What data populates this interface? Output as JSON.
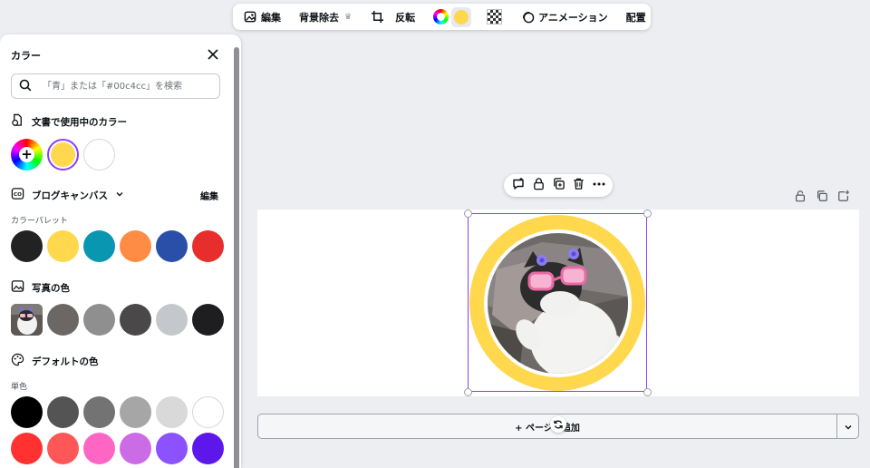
{
  "toolbar": {
    "edit_label": "編集",
    "bg_remove_label": "背景除去",
    "flip_label": "反転",
    "animation_label": "アニメーション",
    "arrange_label": "配置"
  },
  "color_panel": {
    "title": "カラー",
    "search_placeholder": "「青」または「#00c4cc」を検索",
    "doc_colors": {
      "title": "文書で使用中のカラー",
      "swatches": [
        "#ffd84d",
        "#ffffff"
      ]
    },
    "brand_kit": {
      "title": "ブログキャンバス",
      "edit_label": "編集",
      "palette_label": "カラーパレット",
      "swatches": [
        "#222222",
        "#ffd84d",
        "#0996b1",
        "#ff8c45",
        "#2a4fa8",
        "#e82d2d"
      ]
    },
    "photo_colors": {
      "title": "写真の色",
      "swatches": [
        "#6b6765",
        "#8f8f8f",
        "#4a4848",
        "#c4c8cc",
        "#1e1e20"
      ]
    },
    "default_colors": {
      "title": "デフォルトの色",
      "mono_label": "単色",
      "row1": [
        "#000000",
        "#545454",
        "#737373",
        "#a6a6a6",
        "#d9d9d9",
        "#ffffff"
      ],
      "row2": [
        "#ff3131",
        "#ff5757",
        "#ff66c4",
        "#cb6ce6",
        "#8c52ff",
        "#5e17eb"
      ]
    }
  },
  "canvas": {
    "add_page_label": "+ ページを追加"
  },
  "colors": {
    "accent": "#8b3dff",
    "ring": "#ffd84d"
  }
}
